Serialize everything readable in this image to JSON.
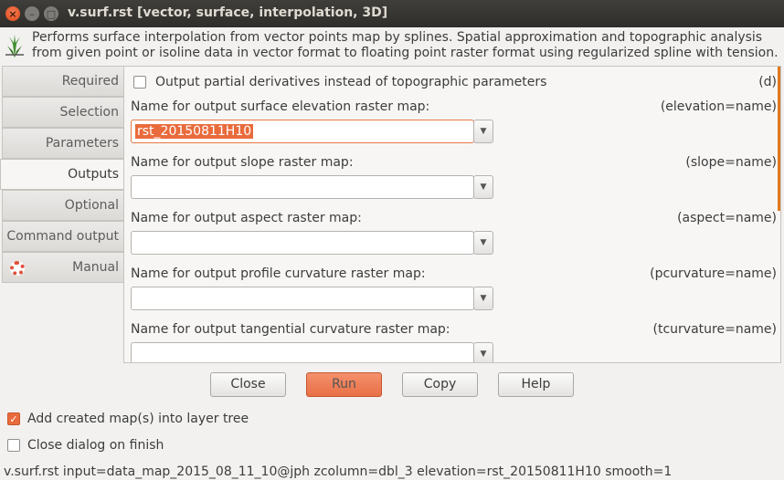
{
  "window": {
    "title": "v.surf.rst [vector, surface, interpolation, 3D]",
    "close_glyph": "×",
    "min_glyph": "–",
    "max_glyph": "□"
  },
  "header": {
    "description": "Performs surface interpolation from vector points map by splines. Spatial approximation and topographic analysis from given point or isoline data in vector format to floating point raster format using regularized spline with tension."
  },
  "tabs": [
    {
      "label": "Required"
    },
    {
      "label": "Selection"
    },
    {
      "label": "Parameters"
    },
    {
      "label": "Outputs",
      "active": true
    },
    {
      "label": "Optional"
    },
    {
      "label": "Command output"
    },
    {
      "label": "Manual",
      "icon": "lifebuoy-icon"
    }
  ],
  "outputs": {
    "deriv_check": {
      "label": "Output partial derivatives instead of topographic parameters",
      "flag": "(d)",
      "checked": false
    },
    "fields": [
      {
        "label": "Name for output surface elevation raster map:",
        "param": "(elevation=name)",
        "value": "rst_20150811H10",
        "selected": true
      },
      {
        "label": "Name for output slope raster map:",
        "param": "(slope=name)",
        "value": ""
      },
      {
        "label": "Name for output aspect raster map:",
        "param": "(aspect=name)",
        "value": ""
      },
      {
        "label": "Name for output profile curvature raster map:",
        "param": "(pcurvature=name)",
        "value": ""
      },
      {
        "label": "Name for output tangential curvature raster map:",
        "param": "(tcurvature=name)",
        "value": ""
      }
    ],
    "combo_glyph": "▼"
  },
  "buttons": {
    "close": "Close",
    "run": "Run",
    "copy": "Copy",
    "help": "Help"
  },
  "options": {
    "add_to_tree": {
      "label": "Add created map(s) into layer tree",
      "checked": true,
      "glyph": "✓"
    },
    "close_on_finish": {
      "label": "Close dialog on finish",
      "checked": false
    }
  },
  "status": {
    "command": "v.surf.rst input=data_map_2015_08_11_10@jph zcolumn=dbl_3 elevation=rst_20150811H10 smooth=1"
  },
  "colors": {
    "accent": "#e96b3c",
    "titlebar": "#3a3935"
  }
}
